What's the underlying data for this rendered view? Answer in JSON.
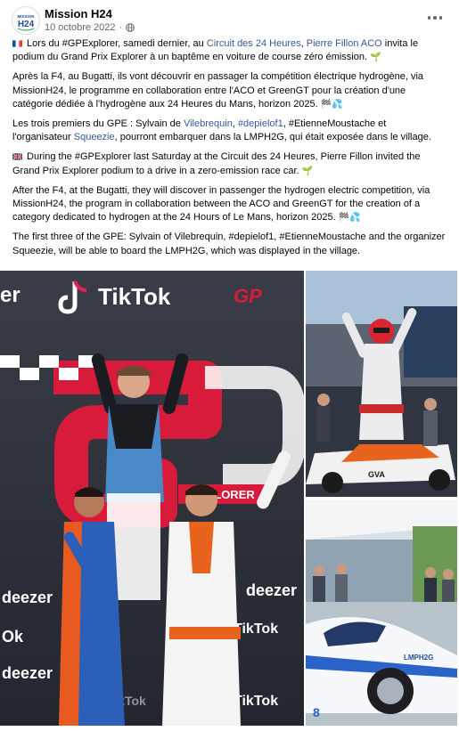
{
  "header": {
    "avatar_text": "MISSION H24",
    "author": "Mission H24",
    "date": "10 octobre 2022",
    "more_label": "..."
  },
  "post": {
    "fr1": {
      "t1": " Lors du #GPExplorer, samedi dernier, au ",
      "link1": "Circuit des 24 Heures",
      "t2": ", ",
      "link2": "Pierre Fillon ACO",
      "t3": " invita le podium du Grand Prix Explorer à un baptême en voiture de course zéro émission. ",
      "emoji": "🌱"
    },
    "fr2": {
      "t1": "Après la F4, au Bugatti, ils vont découvrir en passager la compétition électrique hydrogène, via MissionH24, le programme en collaboration entre l'ACO et GreenGT pour la création d'une catégorie dédiée à l'hydrogène aux 24 Heures du Mans, horizon 2025. ",
      "emoji": "🏁💦"
    },
    "fr3": {
      "t1": "Les trois premiers du GPE : Sylvain de ",
      "link1": "Vilebrequin",
      "t2": ", ",
      "link2": "#depielof1",
      "t3": ", #EtienneMoustache et l'organisateur ",
      "link3": "Squeezie",
      "t4": ", pourront embarquer dans la LMPH2G, qui était exposée dans le village."
    },
    "en1": {
      "t1": " During the #GPExplorer last Saturday at the Circuit des 24 Heures, Pierre Fillon invited the Grand Prix Explorer podium to a drive in a zero-emission race car. ",
      "emoji": "🌱"
    },
    "en2": {
      "t1": "After the F4, at the Bugatti, they will discover in passenger the hydrogen electric competition, via MissionH24, the program in collaboration between the ACO and GreenGT for the creation of a category dedicated to hydrogen at the 24 Hours of Le Mans, horizon 2025. ",
      "emoji": "🏁💦"
    },
    "en3": {
      "t1": "The first three of the GPE: Sylvain of Vilebrequin, #depielof1, #EtienneMoustache and the organizer Squeezie, will be able to board the LMPH2G, which was displayed in the village."
    }
  },
  "photos": {
    "main": {
      "sign_tiktok": "TikTok",
      "sign_gp": "GP",
      "sign_deezer_a": "deezer",
      "sign_deezer_b": "deezer",
      "sign_deezer_c": "deezer",
      "sign_tiktok_b": "TikTok",
      "sign_tiktok_c": "TikTok",
      "sign_tiktok_d": "TikTok",
      "sign_banner": "EXPLORER",
      "sign_er": "er",
      "sign_ok": "Ok"
    },
    "top_right": {
      "car_text": "GVA"
    },
    "bottom_right": {
      "car_text": "LMPH2G"
    }
  },
  "colors": {
    "link": "#385898",
    "meta": "#65676b",
    "brand_blue": "#1c4e9a",
    "tiktok_pink": "#ee1d52",
    "gp_red": "#d81b3a"
  },
  "icons": {
    "globe": "globe-icon",
    "more": "more-options-icon",
    "flag_fr": "flag-fr-icon",
    "flag_uk": "flag-uk-icon"
  }
}
